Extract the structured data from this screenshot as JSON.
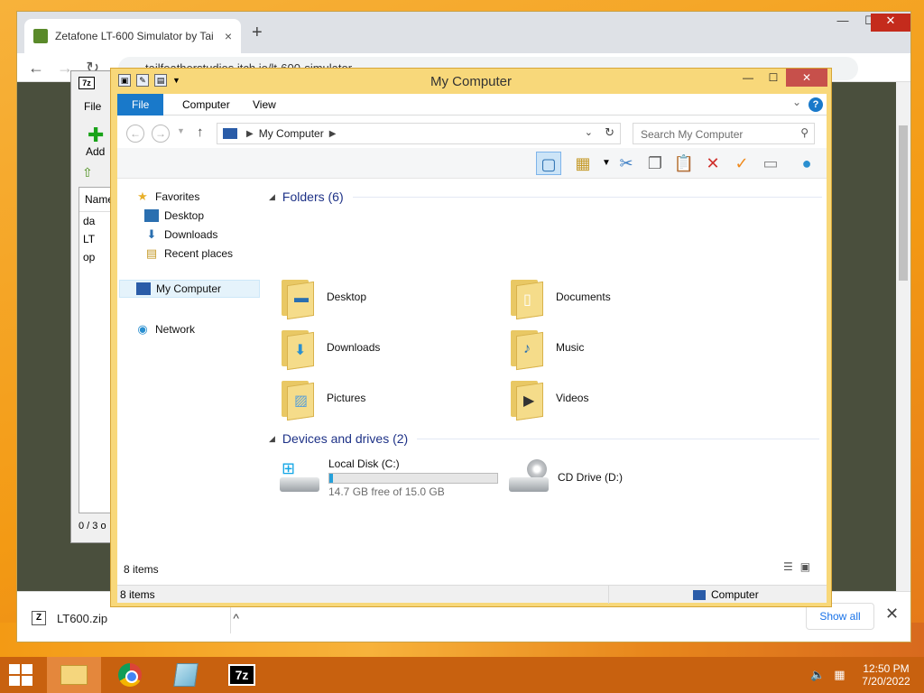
{
  "browser": {
    "tab_title": "Zetafone LT-600 Simulator by Tai",
    "tab_close": "×",
    "new_tab": "+",
    "url": "tailfeatherstudios.itch.io/lt-600-simulator",
    "window_buttons": {
      "minimize": "—",
      "maximize": "☐",
      "close": "✕"
    },
    "nav": {
      "back": "←",
      "forward": "→",
      "reload": "↻"
    },
    "download_bar": {
      "file_name": "LT600.zip",
      "show_all": "Show all",
      "caret": "^",
      "close": "✕"
    }
  },
  "sevenzip": {
    "icon_text": "7z",
    "menu_file": "File",
    "add_label": "Add",
    "list_header": "Name",
    "rows": [
      "da",
      "LT",
      "op"
    ],
    "status": "0 / 3 o"
  },
  "explorer": {
    "title": "My Computer",
    "window_buttons": {
      "minimize": "—",
      "maximize": "☐",
      "close": "✕"
    },
    "ribbon_tabs": [
      "File",
      "Computer",
      "View"
    ],
    "help": "?",
    "address": {
      "path": "My Computer"
    },
    "search_placeholder": "Search My Computer",
    "navpane": {
      "favorites": "Favorites",
      "desktop": "Desktop",
      "downloads": "Downloads",
      "recent": "Recent places",
      "my_computer": "My Computer",
      "network": "Network"
    },
    "folders_header": "Folders (6)",
    "folders": [
      "Desktop",
      "Documents",
      "Downloads",
      "Music",
      "Pictures",
      "Videos"
    ],
    "devices_header": "Devices and drives (2)",
    "drives": {
      "local": {
        "name": "Local Disk (C:)",
        "free_text": "14.7 GB free of 15.0 GB",
        "used_fraction": 0.02
      },
      "cd": {
        "name": "CD Drive (D:)"
      }
    },
    "item_count": "8 items",
    "status_left": "8 items",
    "status_right": "Computer"
  },
  "taskbar": {
    "sevenzip_label": "7z",
    "clock_time": "12:50 PM",
    "clock_date": "7/20/2022"
  }
}
